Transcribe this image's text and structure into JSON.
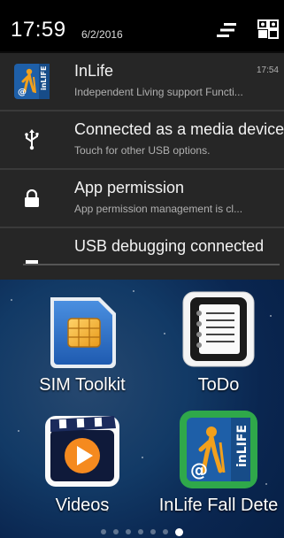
{
  "statusbar": {
    "time": "17:59",
    "date": "6/2/2016",
    "settings_icon": "settings-sliders-icon",
    "user_icon": "profile-icon"
  },
  "notifications": [
    {
      "icon": "inlife-app-icon",
      "title": "InLife",
      "text": "Independent Living support Functi...",
      "time": "17:54"
    },
    {
      "icon": "usb-icon",
      "title": "Connected as a media device",
      "text": "Touch for other USB options."
    },
    {
      "icon": "lock-icon",
      "title": "App permission",
      "text": "App permission management is cl..."
    },
    {
      "icon": "usb-debug-icon",
      "title": "USB debugging connected"
    }
  ],
  "apps": [
    {
      "name": "SIM Toolkit",
      "icon": "sim-card-icon"
    },
    {
      "name": "ToDo",
      "icon": "notepad-icon"
    },
    {
      "name": "Videos",
      "icon": "video-play-icon"
    },
    {
      "name": "InLife Fall Dete",
      "icon": "inlife-app-icon"
    }
  ],
  "pager": {
    "page_count": 7,
    "active_index": 6
  },
  "colors": {
    "notif_bg": "#262626",
    "wallpaper": "#123a66",
    "inlife_blue": "#1e5fa8",
    "inlife_orange": "#f2a01c"
  }
}
